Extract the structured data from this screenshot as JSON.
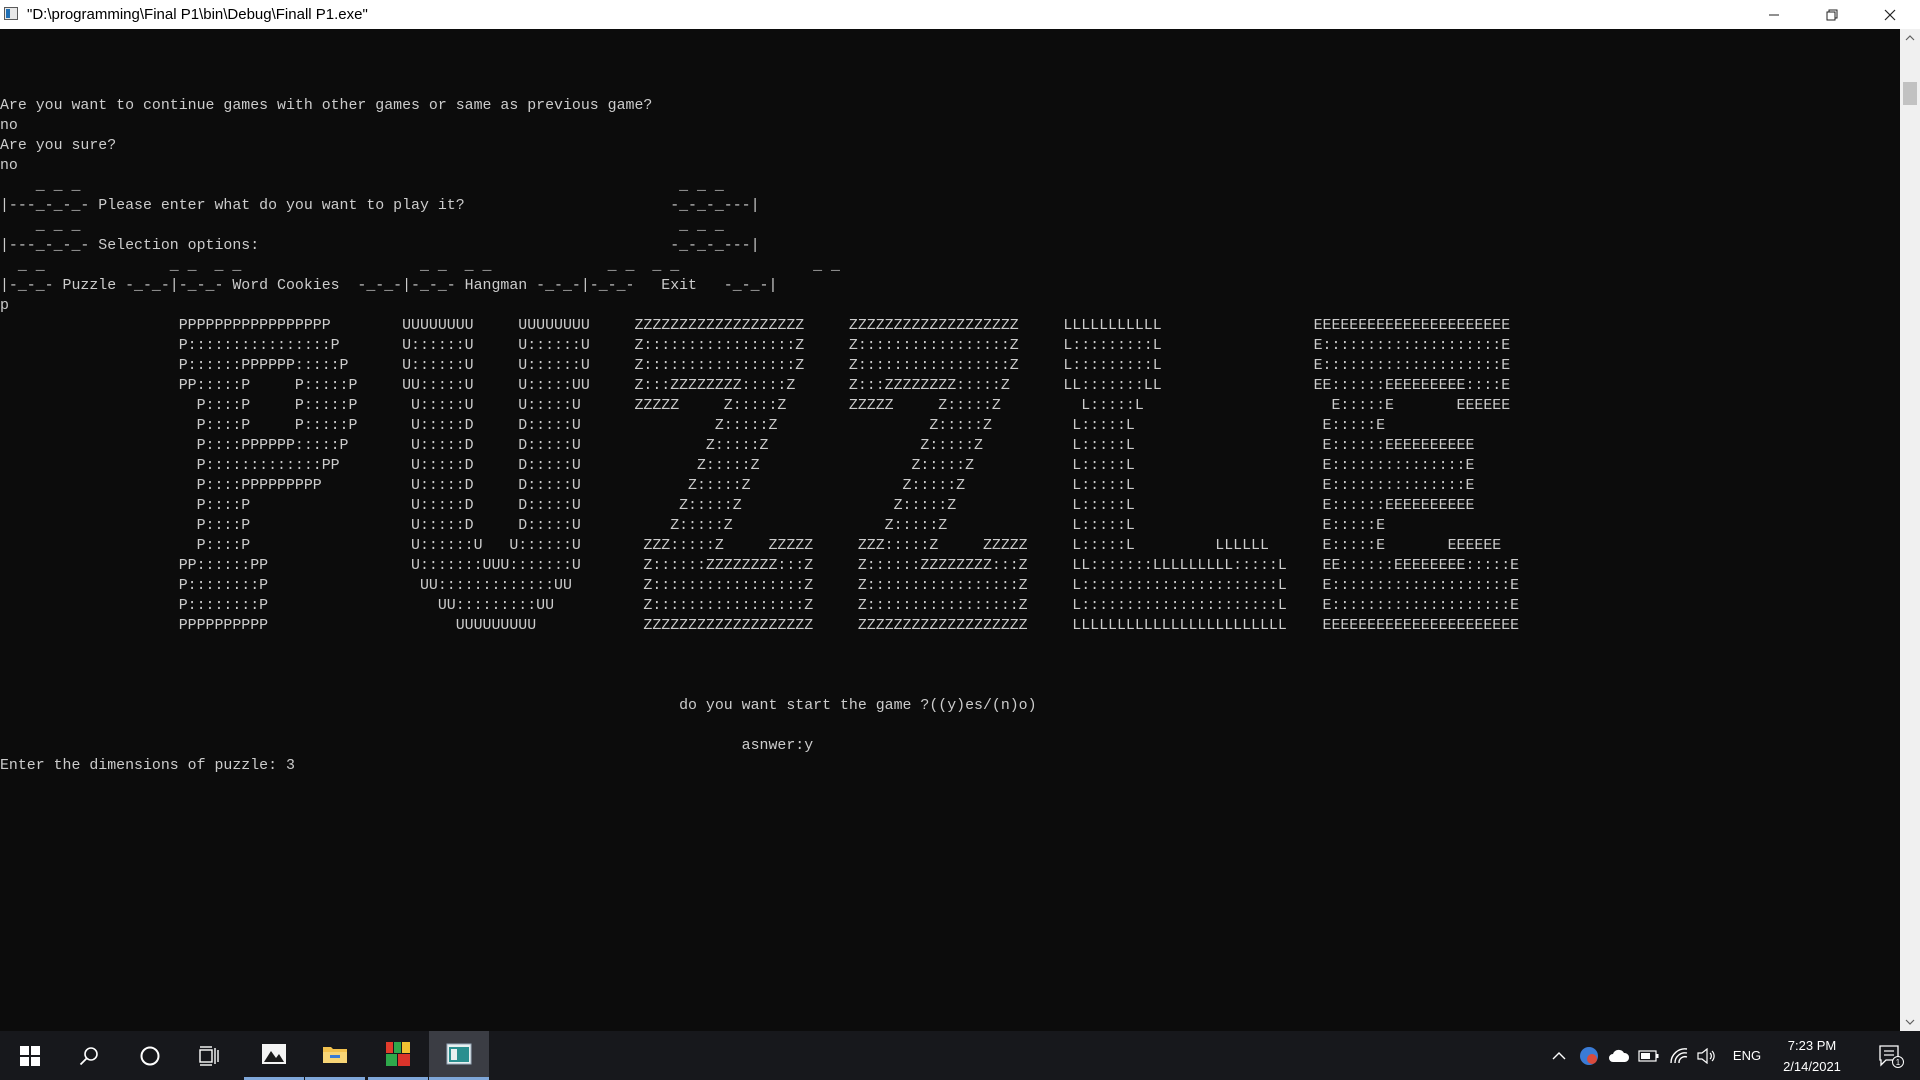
{
  "window": {
    "title": "\"D:\\programming\\Final P1\\bin\\Debug\\Finall P1.exe\"",
    "controls": {
      "minimize": "–",
      "restore": "❐",
      "close": "✕"
    }
  },
  "console": {
    "lines": [
      "",
      "",
      "",
      "Are you want to continue games with other games or same as previous game?",
      "no",
      "Are you sure?",
      "no",
      "    _ _ _                                                                   _ _ _",
      "|---_-_-_- Please enter what do you want to play it?                       -_-_-_---|",
      "    _ _ _                                                                   _ _ _",
      "|---_-_-_- Selection options:                                              -_-_-_---|",
      "  _ _              _ _  _ _                    _ _  _ _             _ _  _ _               _ _",
      "|-_-_- Puzzle -_-_-|-_-_- Word Cookies  -_-_-|-_-_- Hangman -_-_-|-_-_-   Exit   -_-_-|",
      "p",
      "                    PPPPPPPPPPPPPPPPP        UUUUUUUU     UUUUUUUU     ZZZZZZZZZZZZZZZZZZZ     ZZZZZZZZZZZZZZZZZZZ     LLLLLLLLLLL                 EEEEEEEEEEEEEEEEEEEEEE",
      "                    P::::::::::::::::P       U::::::U     U::::::U     Z:::::::::::::::::Z     Z:::::::::::::::::Z     L:::::::::L                 E::::::::::::::::::::E",
      "                    P::::::PPPPPP:::::P      U::::::U     U::::::U     Z:::::::::::::::::Z     Z:::::::::::::::::Z     L:::::::::L                 E::::::::::::::::::::E",
      "                    PP:::::P     P:::::P     UU:::::U     U:::::UU     Z:::ZZZZZZZZ:::::Z      Z:::ZZZZZZZZ:::::Z      LL:::::::LL                 EE::::::EEEEEEEEE::::E",
      "                      P::::P     P:::::P      U:::::U     U:::::U      ZZZZZ     Z:::::Z       ZZZZZ     Z:::::Z         L:::::L                     E:::::E       EEEEEE",
      "                      P::::P     P:::::P      U:::::D     D:::::U               Z:::::Z                 Z:::::Z         L:::::L                     E:::::E",
      "                      P::::PPPPPP:::::P       U:::::D     D:::::U              Z:::::Z                 Z:::::Z          L:::::L                     E::::::EEEEEEEEEE",
      "                      P:::::::::::::PP        U:::::D     D:::::U             Z:::::Z                 Z:::::Z           L:::::L                     E:::::::::::::::E",
      "                      P::::PPPPPPPPP          U:::::D     D:::::U            Z:::::Z                 Z:::::Z            L:::::L                     E:::::::::::::::E",
      "                      P::::P                  U:::::D     D:::::U           Z:::::Z                 Z:::::Z             L:::::L                     E::::::EEEEEEEEEE",
      "                      P::::P                  U:::::D     D:::::U          Z:::::Z                 Z:::::Z              L:::::L                     E:::::E",
      "                      P::::P                  U::::::U   U::::::U       ZZZ:::::Z     ZZZZZ     ZZZ:::::Z     ZZZZZ     L:::::L         LLLLLL      E:::::E       EEEEEE",
      "                    PP::::::PP                U:::::::UUU:::::::U       Z::::::ZZZZZZZZ:::Z     Z::::::ZZZZZZZZ:::Z     LL:::::::LLLLLLLLL:::::L    EE::::::EEEEEEEE:::::E",
      "                    P::::::::P                 UU:::::::::::::UU        Z:::::::::::::::::Z     Z:::::::::::::::::Z     L::::::::::::::::::::::L    E::::::::::::::::::::E",
      "                    P::::::::P                   UU:::::::::UU          Z:::::::::::::::::Z     Z:::::::::::::::::Z     L::::::::::::::::::::::L    E::::::::::::::::::::E",
      "                    PPPPPPPPPP                     UUUUUUUUU            ZZZZZZZZZZZZZZZZZZZ     ZZZZZZZZZZZZZZZZZZZ     LLLLLLLLLLLLLLLLLLLLLLLL    EEEEEEEEEEEEEEEEEEEEEE",
      "",
      "",
      "",
      "                                                                            do you want start the game ?((y)es/(n)o)",
      "",
      "                                                                                   asnwer:y",
      "Enter the dimensions of puzzle: 3"
    ]
  },
  "scrollbar": {
    "up": "▲",
    "down": "▼",
    "position": 0.02
  },
  "taskbar": {
    "items": [
      {
        "name": "start",
        "icon": "windows-logo-icon",
        "running": false
      },
      {
        "name": "search",
        "icon": "search-icon",
        "running": false
      },
      {
        "name": "cortana",
        "icon": "cortana-circle-icon",
        "running": false
      },
      {
        "name": "task-view",
        "icon": "task-view-icon",
        "running": false
      },
      {
        "name": "photos",
        "icon": "photos-icon",
        "running": true
      },
      {
        "name": "file-explorer",
        "icon": "folder-icon",
        "running": true
      },
      {
        "name": "colorful-app",
        "icon": "colorful-grid-icon",
        "running": true
      },
      {
        "name": "console-app",
        "icon": "console-window-icon",
        "running": true,
        "active": true
      }
    ],
    "tray": {
      "chevron": "^",
      "language": "ENG",
      "time": "7:23 PM",
      "date": "2/14/2021",
      "notifications_count": "1"
    }
  },
  "colors": {
    "console_bg": "#0c0c0c",
    "console_fg": "#cccccc",
    "taskbar_bg": "#17181c",
    "taskbar_active": "#3b3d44",
    "running_indicator": "#7fa7d9"
  }
}
